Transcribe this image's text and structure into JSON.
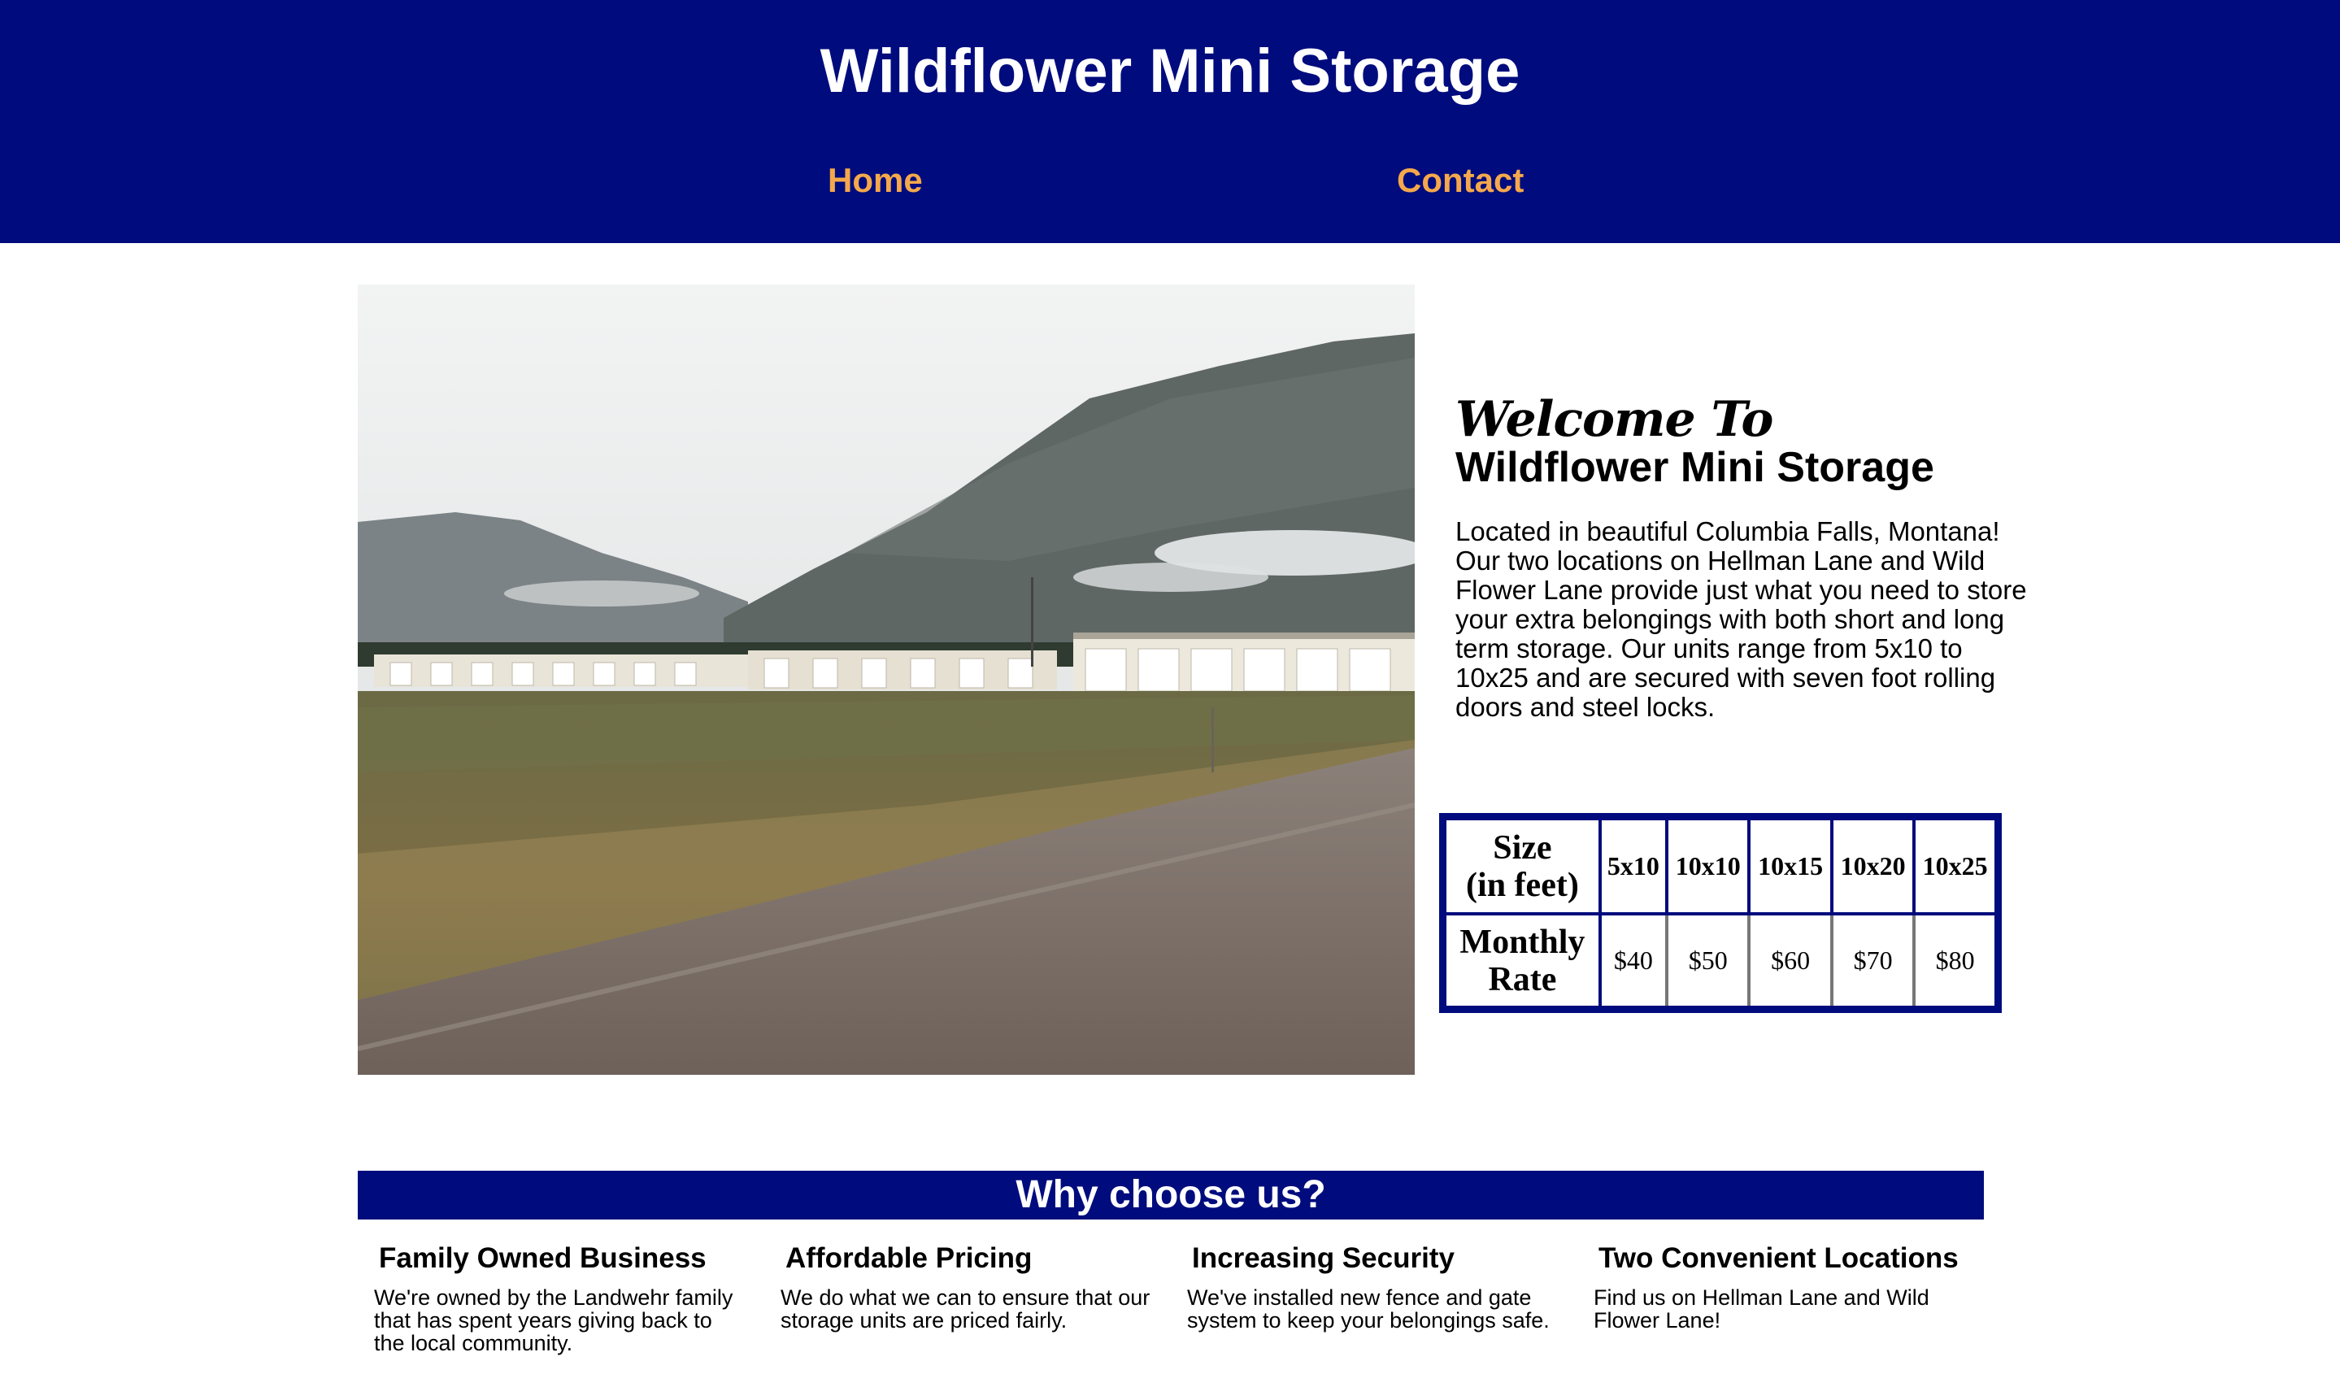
{
  "header": {
    "title": "Wildflower Mini Storage",
    "background_color": "#000c7d",
    "nav": [
      {
        "label": "Home"
      },
      {
        "label": "Contact"
      }
    ],
    "nav_color": "#f5a84b"
  },
  "hero": {
    "image_alt": "storage-units-photo"
  },
  "welcome": {
    "script_heading": "Welcome To",
    "name": "Wildflower Mini Storage",
    "body": "Located in beautiful Columbia Falls, Montana! Our two locations on Hellman Lane and Wild Flower Lane provide just what you need to store your extra belongings with both short and long term storage. Our units range from 5x10 to 10x25 and are secured with seven foot rolling doors and steel locks."
  },
  "rates": {
    "size_label_line1": "Size",
    "size_label_line2": "(in feet)",
    "rate_label_line1": "Monthly",
    "rate_label_line2": "Rate",
    "sizes": [
      "5x10",
      "10x10",
      "10x15",
      "10x20",
      "10x25"
    ],
    "prices": [
      "$40",
      "$50",
      "$60",
      "$70",
      "$80"
    ]
  },
  "why": {
    "heading": "Why choose us?",
    "features": [
      {
        "title": "Family Owned Business",
        "text": "We're owned by the Landwehr family that has spent years giving back to the local community."
      },
      {
        "title": "Affordable Pricing",
        "text": "We do what we can to ensure that our storage units are priced fairly."
      },
      {
        "title": "Increasing Security",
        "text": "We've installed new fence and gate system to keep your belongings safe."
      },
      {
        "title": "Two Convenient Locations",
        "text": "Find us on Hellman Lane and Wild Flower Lane!"
      }
    ]
  }
}
